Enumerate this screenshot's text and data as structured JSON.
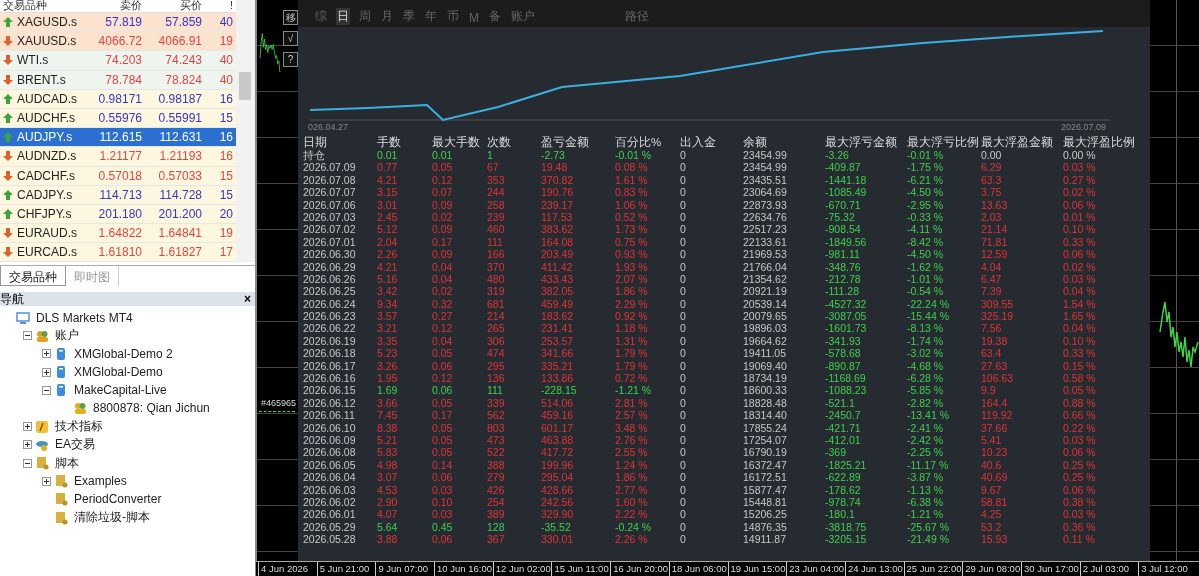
{
  "market_watch": {
    "columns": [
      "交易品种",
      "卖价",
      "买价",
      "!"
    ],
    "rows": [
      {
        "symbol": "XAGUSD.s",
        "bid": "57.819",
        "ask": "57.859",
        "spread": "40",
        "kind": "up",
        "color": "#fbe3cf",
        "selected": false
      },
      {
        "symbol": "XAUUSD.s",
        "bid": "4066.72",
        "ask": "4066.91",
        "spread": "19",
        "kind": "down",
        "color": "#fbe3cf",
        "selected": false
      },
      {
        "symbol": "WTI.s",
        "bid": "74.203",
        "ask": "74.243",
        "spread": "40",
        "kind": "down",
        "color": "#eef5ef",
        "selected": false
      },
      {
        "symbol": "BRENT.s",
        "bid": "78.784",
        "ask": "78.824",
        "spread": "40",
        "kind": "down",
        "color": "#eef5ef",
        "selected": false
      },
      {
        "symbol": "AUDCAD.s",
        "bid": "0.98171",
        "ask": "0.98187",
        "spread": "16",
        "kind": "up",
        "color": "#fdf7df",
        "selected": false
      },
      {
        "symbol": "AUDCHF.s",
        "bid": "0.55976",
        "ask": "0.55991",
        "spread": "15",
        "kind": "up",
        "color": "#fdf7df",
        "selected": false
      },
      {
        "symbol": "AUDJPY.s",
        "bid": "112.615",
        "ask": "112.631",
        "spread": "16",
        "kind": "up",
        "selected": true
      },
      {
        "symbol": "AUDNZD.s",
        "bid": "1.21177",
        "ask": "1.21193",
        "spread": "16",
        "kind": "down",
        "color": "#fdf7df",
        "selected": false
      },
      {
        "symbol": "CADCHF.s",
        "bid": "0.57018",
        "ask": "0.57033",
        "spread": "15",
        "kind": "down",
        "color": "#fdf7df",
        "selected": false
      },
      {
        "symbol": "CADJPY.s",
        "bid": "114.713",
        "ask": "114.728",
        "spread": "15",
        "kind": "up",
        "color": "#fdf7df",
        "selected": false
      },
      {
        "symbol": "CHFJPY.s",
        "bid": "201.180",
        "ask": "201.200",
        "spread": "20",
        "kind": "up",
        "color": "#fdf7df",
        "selected": false
      },
      {
        "symbol": "EURAUD.s",
        "bid": "1.64822",
        "ask": "1.64841",
        "spread": "19",
        "kind": "down",
        "color": "#fdf7df",
        "selected": false
      },
      {
        "symbol": "EURCAD.s",
        "bid": "1.61810",
        "ask": "1.61827",
        "spread": "17",
        "kind": "down",
        "color": "#fdf7df",
        "selected": false
      }
    ],
    "tabs": [
      {
        "label": "交易品种",
        "selected": true
      },
      {
        "label": "即时图",
        "selected": false
      }
    ]
  },
  "navigator": {
    "title": "导航",
    "close": "×",
    "tree": [
      {
        "label": "DLS Markets MT4",
        "kind": "terminal",
        "children": [
          {
            "label": "账户",
            "kind": "accounts",
            "expanded": true,
            "children": [
              {
                "label": "XMGlobal-Demo 2",
                "kind": "server",
                "expanded": false
              },
              {
                "label": "XMGlobal-Demo",
                "kind": "server",
                "expanded": false
              },
              {
                "label": "MakeCapital-Live",
                "kind": "server",
                "expanded": true,
                "children": [
                  {
                    "label": "8800878: Qian Jichun",
                    "kind": "user"
                  }
                ]
              }
            ]
          },
          {
            "label": "技术指标",
            "kind": "indicators",
            "expanded": false
          },
          {
            "label": "EA交易",
            "kind": "experts",
            "expanded": false
          },
          {
            "label": "脚本",
            "kind": "scripts",
            "expanded": true,
            "children": [
              {
                "label": "Examples",
                "kind": "script",
                "expanded": false
              },
              {
                "label": "PeriodConverter",
                "kind": "script"
              },
              {
                "label": "清除垃圾-脚本",
                "kind": "script"
              }
            ]
          }
        ]
      }
    ]
  },
  "chart": {
    "side_buttons": [
      "移",
      "√",
      "?"
    ],
    "order_label": "#465965",
    "time_axis": [
      "4 Jun 2026",
      "5 Jun 21:00",
      "9 Jun 07:00",
      "10 Jun 16:00",
      "12 Jun 02:00",
      "15 Jun 11:00",
      "16 Jun 20:00",
      "18 Jun 06:00",
      "19 Jun 15:00",
      "23 Jun 04:00",
      "24 Jun 13:00",
      "25 Jun 22:00",
      "29 Jun 08:00",
      "30 Jun 17:00",
      "2 Jul 03:00",
      "3 Jul 12:00"
    ]
  },
  "stats_panel": {
    "tabs": [
      {
        "label": "综",
        "selected": false
      },
      {
        "label": "日",
        "selected": true
      },
      {
        "label": "周",
        "selected": false
      },
      {
        "label": "月",
        "selected": false
      },
      {
        "label": "季",
        "selected": false
      },
      {
        "label": "年",
        "selected": false
      },
      {
        "label": "币",
        "selected": false
      },
      {
        "label": "M",
        "selected": false
      },
      {
        "label": "备",
        "selected": false
      },
      {
        "label": "账户",
        "selected": false
      }
    ],
    "path_label": "路径",
    "equity_start": "026.04.27",
    "equity_end": "2026.07.09",
    "table": {
      "columns": [
        "日期",
        "手数",
        "最大手数",
        "次数",
        "盈亏金额",
        "百分比%",
        "出入金",
        "余额",
        "最大浮亏金额",
        "最大浮亏比例",
        "最大浮盈金额",
        "最大浮盈比例"
      ],
      "rows": [
        {
          "cells": [
            "持仓",
            "0.01",
            "0.01",
            "1",
            "-2.73",
            "-0.01 %",
            "0",
            "23454.99",
            "-3.26",
            "-0.01 %",
            "0.00",
            "0.00 %"
          ],
          "kind": "open"
        },
        {
          "cells": [
            "2026.07.09",
            "0.77",
            "0.05",
            "67",
            "19.48",
            "0.08 %",
            "0",
            "23454.99",
            "-409.87",
            "-1.75 %",
            "6.29",
            "0.03 %"
          ],
          "kind": "gain"
        },
        {
          "cells": [
            "2026.07.08",
            "4.21",
            "0.12",
            "353",
            "370.82",
            "1.61 %",
            "0",
            "23435.51",
            "-1441.18",
            "-6.21 %",
            "63.3",
            "0.27 %"
          ],
          "kind": "gain"
        },
        {
          "cells": [
            "2026.07.07",
            "3.15",
            "0.07",
            "244",
            "190.76",
            "0.83 %",
            "0",
            "23064.69",
            "-1085.49",
            "-4.50 %",
            "3.75",
            "0.02 %"
          ],
          "kind": "gain"
        },
        {
          "cells": [
            "2026.07.06",
            "3.01",
            "0.09",
            "258",
            "239.17",
            "1.06 %",
            "0",
            "22873.93",
            "-670.71",
            "-2.95 %",
            "13.63",
            "0.06 %"
          ],
          "kind": "gain"
        },
        {
          "cells": [
            "2026.07.03",
            "2.45",
            "0.02",
            "239",
            "117.53",
            "0.52 %",
            "0",
            "22634.76",
            "-75.32",
            "-0.33 %",
            "2.03",
            "0.01 %"
          ],
          "kind": "gain"
        },
        {
          "cells": [
            "2026.07.02",
            "5.12",
            "0.09",
            "460",
            "383.62",
            "1.73 %",
            "0",
            "22517.23",
            "-908.54",
            "-4.11 %",
            "21.14",
            "0.10 %"
          ],
          "kind": "gain"
        },
        {
          "cells": [
            "2026.07.01",
            "2.04",
            "0.17",
            "111",
            "164.08",
            "0.75 %",
            "0",
            "22133.61",
            "-1849.56",
            "-8.42 %",
            "71.81",
            "0.33 %"
          ],
          "kind": "gain"
        },
        {
          "cells": [
            "2026.06.30",
            "2.26",
            "0.09",
            "166",
            "203.49",
            "0.93 %",
            "0",
            "21969.53",
            "-981.11",
            "-4.50 %",
            "12.59",
            "0.06 %"
          ],
          "kind": "gain"
        },
        {
          "cells": [
            "2026.06.29",
            "4.21",
            "0.04",
            "370",
            "411.42",
            "1.93 %",
            "0",
            "21766.04",
            "-348.76",
            "-1.62 %",
            "4.04",
            "0.02 %"
          ],
          "kind": "gain"
        },
        {
          "cells": [
            "2026.06.26",
            "5.16",
            "0.04",
            "480",
            "433.43",
            "2.07 %",
            "0",
            "21354.62",
            "-212.78",
            "-1.01 %",
            "6.47",
            "0.03 %"
          ],
          "kind": "gain"
        },
        {
          "cells": [
            "2026.06.25",
            "3.42",
            "0.02",
            "319",
            "382.05",
            "1.86 %",
            "0",
            "20921.19",
            "-111.28",
            "-0.54 %",
            "7.39",
            "0.04 %"
          ],
          "kind": "gain"
        },
        {
          "cells": [
            "2026.06.24",
            "9.34",
            "0.32",
            "681",
            "459.49",
            "2.29 %",
            "0",
            "20539.14",
            "-4527.32",
            "-22.24 %",
            "309.55",
            "1.54 %"
          ],
          "kind": "gain"
        },
        {
          "cells": [
            "2026.06.23",
            "3.57",
            "0.27",
            "214",
            "183.62",
            "0.92 %",
            "0",
            "20079.65",
            "-3087.05",
            "-15.44 %",
            "325.19",
            "1.65 %"
          ],
          "kind": "gain"
        },
        {
          "cells": [
            "2026.06.22",
            "3.21",
            "0.12",
            "265",
            "231.41",
            "1.18 %",
            "0",
            "19896.03",
            "-1601.73",
            "-8.13 %",
            "7.56",
            "0.04 %"
          ],
          "kind": "gain"
        },
        {
          "cells": [
            "2026.06.19",
            "3.35",
            "0.04",
            "306",
            "253.57",
            "1.31 %",
            "0",
            "19664.62",
            "-341.93",
            "-1.74 %",
            "19.38",
            "0.10 %"
          ],
          "kind": "gain"
        },
        {
          "cells": [
            "2026.06.18",
            "5.23",
            "0.05",
            "474",
            "341.66",
            "1.79 %",
            "0",
            "19411.05",
            "-578.68",
            "-3.02 %",
            "63.4",
            "0.33 %"
          ],
          "kind": "gain"
        },
        {
          "cells": [
            "2026.06.17",
            "3.26",
            "0.06",
            "295",
            "335.21",
            "1.79 %",
            "0",
            "19069.40",
            "-890.87",
            "-4.68 %",
            "27.63",
            "0.15 %"
          ],
          "kind": "gain"
        },
        {
          "cells": [
            "2026.06.16",
            "1.95",
            "0.12",
            "136",
            "133.86",
            "0.72 %",
            "0",
            "18734.19",
            "-1168.69",
            "-6.28 %",
            "106.63",
            "0.58 %"
          ],
          "kind": "gain"
        },
        {
          "cells": [
            "2026.06.15",
            "1.69",
            "0.06",
            "111",
            "-228.15",
            "-1.21 %",
            "0",
            "18600.33",
            "-1088.23",
            "-5.85 %",
            "9.9",
            "0.05 %"
          ],
          "kind": "loss"
        },
        {
          "cells": [
            "2026.06.12",
            "3.66",
            "0.05",
            "339",
            "514.06",
            "2.81 %",
            "0",
            "18828.48",
            "-521.1",
            "-2.82 %",
            "164.4",
            "0.88 %"
          ],
          "kind": "gain"
        },
        {
          "cells": [
            "2026.06.11",
            "7.45",
            "0.17",
            "562",
            "459.16",
            "2.57 %",
            "0",
            "18314.40",
            "-2450.7",
            "-13.41 %",
            "119.92",
            "0.66 %"
          ],
          "kind": "gain"
        },
        {
          "cells": [
            "2026.06.10",
            "8.38",
            "0.05",
            "803",
            "601.17",
            "3.48 %",
            "0",
            "17855.24",
            "-421.71",
            "-2.41 %",
            "37.66",
            "0.22 %"
          ],
          "kind": "gain"
        },
        {
          "cells": [
            "2026.06.09",
            "5.21",
            "0.05",
            "473",
            "463.88",
            "2.76 %",
            "0",
            "17254.07",
            "-412.01",
            "-2.42 %",
            "5.41",
            "0.03 %"
          ],
          "kind": "gain"
        },
        {
          "cells": [
            "2026.06.08",
            "5.83",
            "0.05",
            "522",
            "417.72",
            "2.55 %",
            "0",
            "16790.19",
            "-369",
            "-2.25 %",
            "10.23",
            "0.06 %"
          ],
          "kind": "gain"
        },
        {
          "cells": [
            "2026.06.05",
            "4.98",
            "0.14",
            "388",
            "199.96",
            "1.24 %",
            "0",
            "16372.47",
            "-1825.21",
            "-11.17 %",
            "40.6",
            "0.25 %"
          ],
          "kind": "gain"
        },
        {
          "cells": [
            "2026.06.04",
            "3.07",
            "0.06",
            "279",
            "295.04",
            "1.86 %",
            "0",
            "16172.51",
            "-622.89",
            "-3.87 %",
            "40.69",
            "0.25 %"
          ],
          "kind": "gain"
        },
        {
          "cells": [
            "2026.06.03",
            "4.53",
            "0.03",
            "426",
            "428.66",
            "2.77 %",
            "0",
            "15877.47",
            "-178.62",
            "-1.13 %",
            "9.67",
            "0.06 %"
          ],
          "kind": "gain"
        },
        {
          "cells": [
            "2026.06.02",
            "2.90",
            "0.10",
            "254",
            "242.56",
            "1.60 %",
            "0",
            "15448.81",
            "-978.74",
            "-6.38 %",
            "58.81",
            "0.38 %"
          ],
          "kind": "gain"
        },
        {
          "cells": [
            "2026.06.01",
            "4.07",
            "0.03",
            "389",
            "329.90",
            "2.22 %",
            "0",
            "15206.25",
            "-180.1",
            "-1.21 %",
            "4.25",
            "0.03 %"
          ],
          "kind": "gain"
        },
        {
          "cells": [
            "2026.05.29",
            "5.64",
            "0.45",
            "128",
            "-35.52",
            "-0.24 %",
            "0",
            "14876.35",
            "-3818.75",
            "-25.67 %",
            "53.2",
            "0.36 %"
          ],
          "kind": "loss"
        },
        {
          "cells": [
            "2026.05.28",
            "3.88",
            "0.06",
            "367",
            "330.01",
            "2.26 %",
            "0",
            "14911.87",
            "-3205.15",
            "-21.49 %",
            "15.93",
            "0.11 %"
          ],
          "kind": "gain"
        }
      ]
    }
  }
}
